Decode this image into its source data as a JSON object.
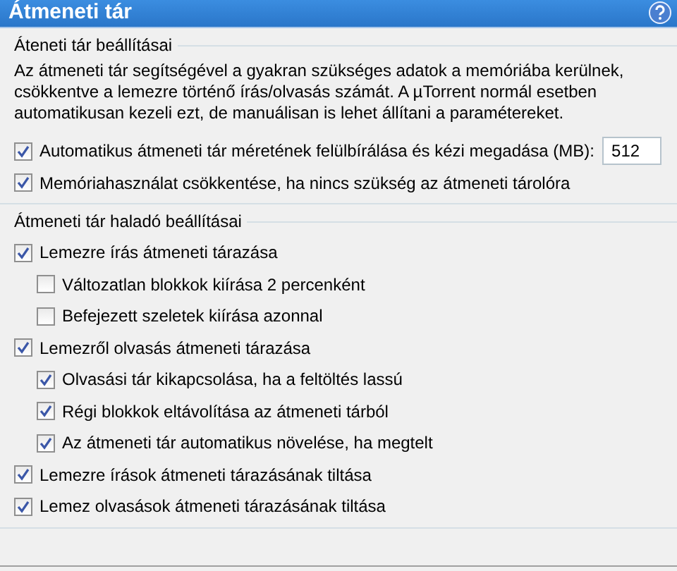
{
  "window": {
    "title": "Átmeneti tár"
  },
  "sections": [
    {
      "title": "Áteneti tár beállításai",
      "description": "Az átmeneti tár segítségével a gyakran szükséges adatok a memóriába kerülnek, csökkentve a lemezre történő írás/olvasás számát. A µTorrent normál esetben automatikusan kezeli ezt, de manuálisan is lehet állítani a paramétereket.",
      "options": [
        {
          "label": "Automatikus átmeneti tár méretének felülbírálása és kézi megadása (MB):",
          "checked": true,
          "field": {
            "value": "512"
          }
        },
        {
          "label": "Memóriahasználat csökkentése, ha nincs szükség az átmeneti tárolóra",
          "checked": true
        }
      ]
    },
    {
      "title": "Átmeneti tár haladó beállításai",
      "options": [
        {
          "label": "Lemezre írás átmeneti tárazása",
          "checked": true,
          "children": [
            {
              "label": "Változatlan blokkok kiírása 2 percenként",
              "checked": false
            },
            {
              "label": "Befejezett szeletek kiírása azonnal",
              "checked": false
            }
          ]
        },
        {
          "label": "Lemezről olvasás átmeneti tárazása",
          "checked": true,
          "children": [
            {
              "label": "Olvasási tár kikapcsolása, ha a feltöltés lassú",
              "checked": true
            },
            {
              "label": "Régi blokkok eltávolítása az átmeneti tárból",
              "checked": true
            },
            {
              "label": "Az átmeneti tár automatikus növelése, ha megtelt",
              "checked": true
            }
          ]
        },
        {
          "label": "Lemezre írások átmeneti tárazásának tiltása",
          "checked": true
        },
        {
          "label": "Lemez olvasások átmeneti tárazásának tiltása",
          "checked": true
        }
      ]
    }
  ]
}
